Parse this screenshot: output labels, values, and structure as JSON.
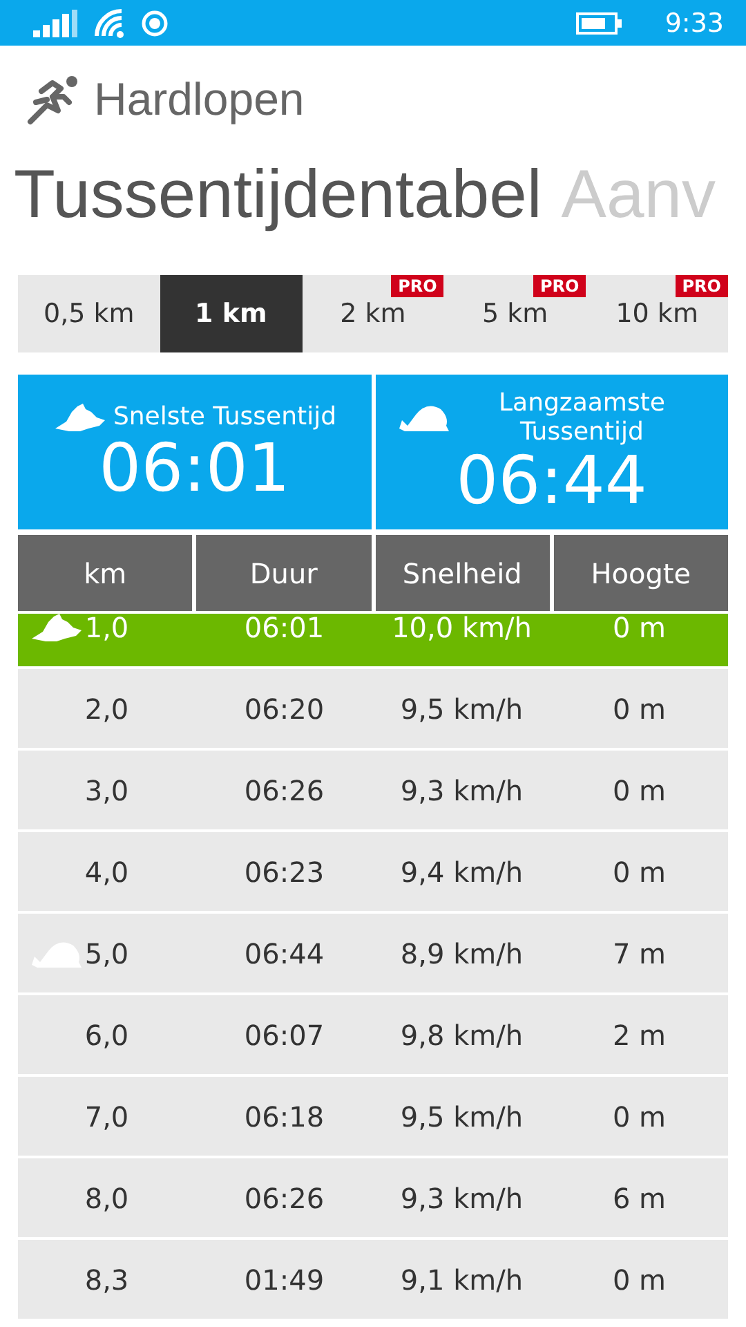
{
  "status_bar": {
    "time": "9:33"
  },
  "app_title": "Hardlopen",
  "pivot": [
    {
      "label": "Tussentijdentabel",
      "selected": true
    },
    {
      "label": "Aanv",
      "selected": false
    }
  ],
  "segments": [
    {
      "label": "0,5 km",
      "selected": false,
      "pro": false
    },
    {
      "label": "1 km",
      "selected": true,
      "pro": false
    },
    {
      "label": "2 km",
      "selected": false,
      "pro": true,
      "badge": "PRO"
    },
    {
      "label": "5 km",
      "selected": false,
      "pro": true,
      "badge": "PRO"
    },
    {
      "label": "10 km",
      "selected": false,
      "pro": true,
      "badge": "PRO"
    }
  ],
  "summary": [
    {
      "kind": "fastest",
      "label": "Snelste Tussentijd",
      "value": "06:01"
    },
    {
      "kind": "slowest",
      "label": "Langzaamste Tussentijd",
      "value": "06:44"
    }
  ],
  "table": {
    "columns": [
      "km",
      "Duur",
      "Snelheid",
      "Hoogte"
    ],
    "rows": [
      {
        "kind": "fastest",
        "cells": [
          "1,0",
          "06:01",
          "10,0 km/h",
          "0 m"
        ]
      },
      {
        "kind": "normal",
        "cells": [
          "2,0",
          "06:20",
          "9,5 km/h",
          "0 m"
        ]
      },
      {
        "kind": "normal",
        "cells": [
          "3,0",
          "06:26",
          "9,3 km/h",
          "0 m"
        ]
      },
      {
        "kind": "normal",
        "cells": [
          "4,0",
          "06:23",
          "9,4 km/h",
          "0 m"
        ]
      },
      {
        "kind": "slowest",
        "cells": [
          "5,0",
          "06:44",
          "8,9 km/h",
          "7 m"
        ]
      },
      {
        "kind": "normal",
        "cells": [
          "6,0",
          "06:07",
          "9,8 km/h",
          "2 m"
        ]
      },
      {
        "kind": "normal",
        "cells": [
          "7,0",
          "06:18",
          "9,5 km/h",
          "0 m"
        ]
      },
      {
        "kind": "normal",
        "cells": [
          "8,0",
          "06:26",
          "9,3 km/h",
          "6 m"
        ]
      },
      {
        "kind": "normal",
        "cells": [
          "8,3",
          "01:49",
          "9,1 km/h",
          "0 m"
        ]
      }
    ]
  }
}
